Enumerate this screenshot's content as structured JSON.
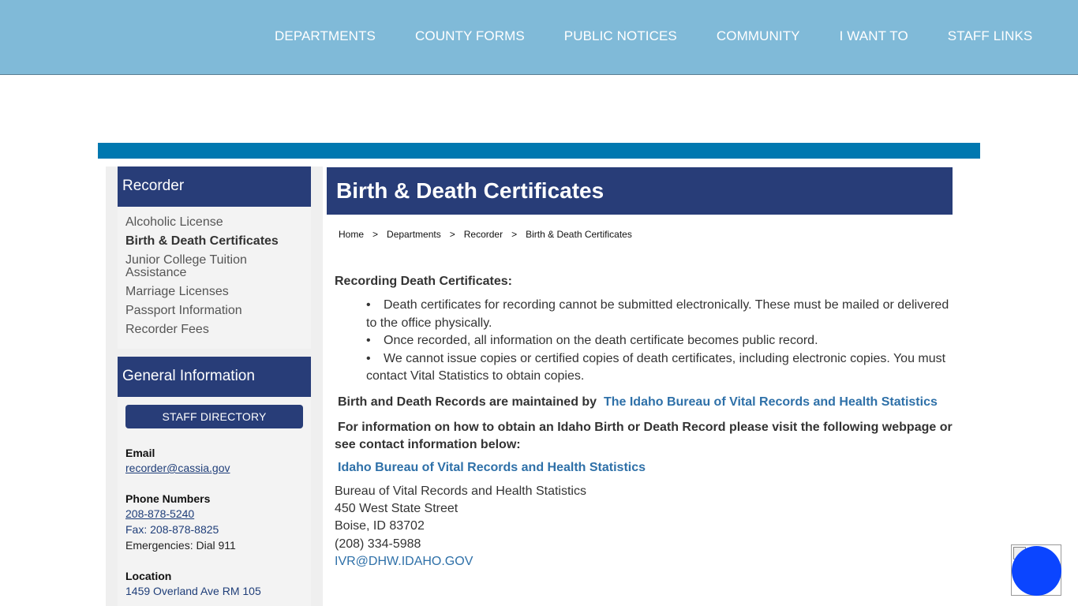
{
  "nav": {
    "items": [
      "DEPARTMENTS",
      "COUNTY FORMS",
      "PUBLIC NOTICES",
      "COMMUNITY",
      "I WANT TO",
      "STAFF LINKS"
    ]
  },
  "sidebar": {
    "recorder_title": "Recorder",
    "links": [
      {
        "label": "Alcoholic License",
        "active": false
      },
      {
        "label": "Birth & Death Certificates",
        "active": true
      },
      {
        "label": "Junior College Tuition Assistance",
        "active": false
      },
      {
        "label": "Marriage Licenses",
        "active": false
      },
      {
        "label": "Passport Information",
        "active": false
      },
      {
        "label": "Recorder Fees",
        "active": false
      }
    ],
    "general_title": "General Information",
    "staff_button": "STAFF DIRECTORY",
    "email_label": "Email",
    "email": "recorder@cassia.gov",
    "phone_label": "Phone Numbers",
    "phone": "208-878-5240",
    "fax": "Fax: 208-878-8825",
    "emergencies": "Emergencies: Dial 911",
    "location_label": "Location",
    "address": "1459 Overland Ave RM 105"
  },
  "page": {
    "title": "Birth & Death Certificates",
    "breadcrumb": [
      "Home",
      "Departments",
      "Recorder",
      "Birth & Death Certificates"
    ],
    "breadcrumb_sep": ">",
    "section_heading": "Recording Death Certificates:",
    "bullets": [
      "Death certificates for recording cannot be submitted electronically. These must be mailed or delivered to the office physically.",
      "Once recorded, all information on the death certificate becomes public record.",
      "We cannot issue copies or certified copies of death certificates, including electronic copies. You must contact Vital Statistics to obtain copies."
    ],
    "maintained_text": "Birth and Death Records are maintained by",
    "maintained_link": "The Idaho Bureau of Vital Records and Health Statistics",
    "info_text": "For information on how to obtain an Idaho Birth or Death Record please visit the following webpage or see contact information below:",
    "bureau_link": "Idaho Bureau of Vital Records and Health Statistics",
    "address_lines": [
      "Bureau of Vital Records and Health Statistics",
      "450 West State Street",
      "Boise, ID 83702",
      "(208) 334-5988"
    ],
    "email": "IVR@DHW.IDAHO.GOV"
  },
  "colors": {
    "topbar": "#80bad8",
    "navy": "#283d78",
    "strip": "#0078b0",
    "link": "#2e70a8",
    "a11y": "#0b45ff"
  },
  "icons": {
    "accessibility": "accessibility-icon"
  }
}
